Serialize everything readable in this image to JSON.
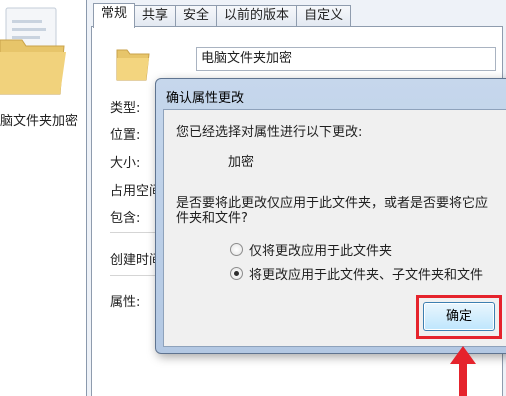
{
  "desktop": {
    "folder_label": "脑文件夹加密"
  },
  "properties": {
    "tabs": [
      "常规",
      "共享",
      "安全",
      "以前的版本",
      "自定义"
    ],
    "folder_name": "电脑文件夹加密",
    "labels": {
      "type": "类型:",
      "location": "位置:",
      "size": "大小:",
      "size_on_disk": "占用空间",
      "contains": "包含:",
      "created": "创建时间",
      "attributes": "属性:"
    }
  },
  "dialog": {
    "title": "确认属性更改",
    "intro": "您已经选择对属性进行以下更改:",
    "change": "加密",
    "question_line1": "是否要将此更改仅应用于此文件夹，或者是否要将它应",
    "question_line2": "件夹和文件?",
    "option_folder_only": "仅将更改应用于此文件夹",
    "option_all": "将更改应用于此文件夹、子文件夹和文件",
    "selected_option": "option_all",
    "ok_label": "确定"
  },
  "annotation": {
    "highlight_color": "#e5232c"
  }
}
